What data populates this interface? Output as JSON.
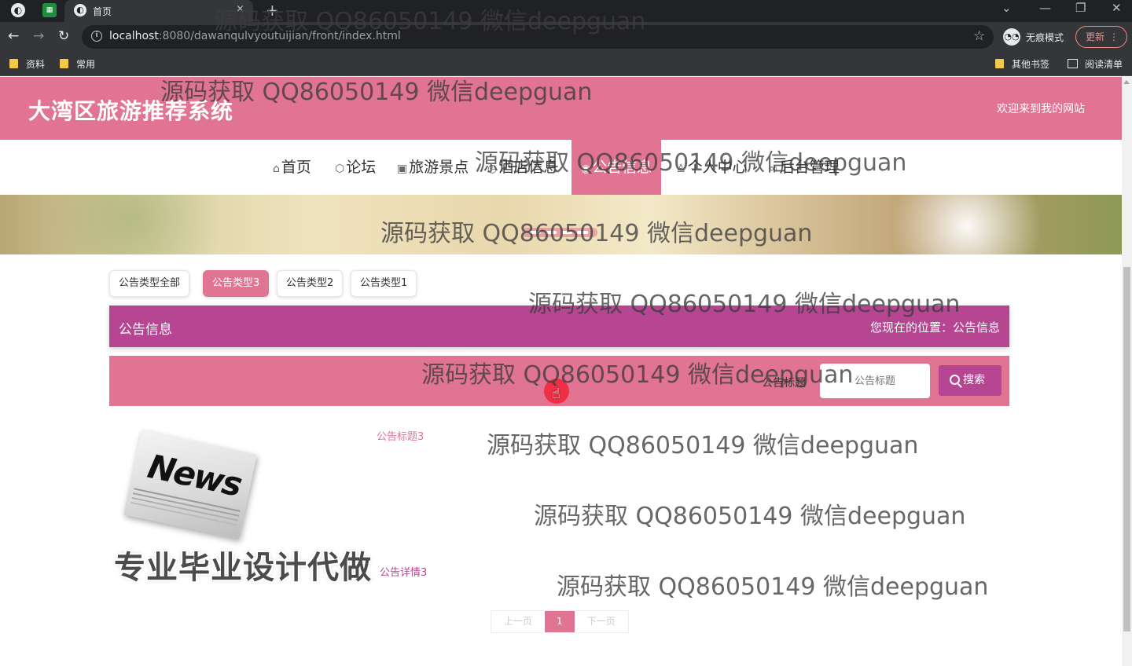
{
  "browser": {
    "tab_title": "首页",
    "tab_close": "×",
    "new_tab": "+",
    "url_host": "localhost",
    "url_path": ":8080/dawanqulvyoutuijian/front/index.html",
    "incognito_label": "无痕模式",
    "update_label": "更新",
    "bookmarks": [
      "资料",
      "常用"
    ],
    "bookmarks_right": [
      "其他书签",
      "阅读清单"
    ]
  },
  "site": {
    "title": "大湾区旅游推荐系统",
    "welcome": "欢迎来到我的网站"
  },
  "nav": [
    {
      "icon": "home-icon",
      "glyph": "⌂",
      "label": "首页"
    },
    {
      "icon": "cube-icon",
      "glyph": "⬡",
      "label": "论坛"
    },
    {
      "icon": "gift-icon",
      "glyph": "▣",
      "label": "旅游景点"
    },
    {
      "icon": "clock-icon",
      "glyph": "◷",
      "label": "酒店信息"
    },
    {
      "icon": "globe-icon",
      "glyph": "◉",
      "label": "公告信息",
      "active": true
    },
    {
      "icon": "user-icon",
      "glyph": "♙",
      "label": "个人中心"
    },
    {
      "icon": "link-icon",
      "glyph": "∞",
      "label": "后台管理"
    }
  ],
  "type_filters": [
    "公告类型全部",
    "公告类型3",
    "公告类型2",
    "公告类型1"
  ],
  "active_filter": "公告类型3",
  "section": {
    "title": "公告信息",
    "breadcrumb": "您现在的位置：公告信息"
  },
  "search": {
    "label": "公告标题",
    "placeholder": "公告标题",
    "button": "搜索"
  },
  "news": {
    "image_word": "News",
    "title": "公告标题3",
    "detail": "公告详情3"
  },
  "pagination": {
    "prev": "上一页",
    "current": "1",
    "next": "下一页"
  },
  "overlay": {
    "watermark": "源码获取 QQ86050149 微信deepguan",
    "promo": "专业毕业设计代做"
  },
  "colors": {
    "primary_pink": "#e17393",
    "accent_magenta": "#b64592"
  }
}
